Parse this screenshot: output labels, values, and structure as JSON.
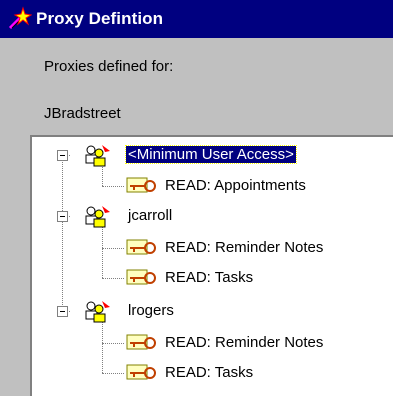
{
  "window": {
    "title": "Proxy Defintion"
  },
  "labels": {
    "proxies_for": "Proxies defined for:",
    "owner": "JBradstreet"
  },
  "tree": {
    "groups": [
      {
        "name": "<Minimum User Access>",
        "selected": true,
        "items": [
          "READ: Appointments"
        ]
      },
      {
        "name": "jcarroll",
        "selected": false,
        "items": [
          "READ: Reminder Notes",
          "READ: Tasks"
        ]
      },
      {
        "name": "lrogers",
        "selected": false,
        "items": [
          "READ: Reminder Notes",
          "READ: Tasks"
        ]
      }
    ]
  },
  "colors": {
    "titlebar": "#000080",
    "selection": "#000080",
    "dialog": "#c0c0c0"
  },
  "icons": {
    "window": "wand-icon",
    "group": "users-icon",
    "permission": "key-icon"
  }
}
